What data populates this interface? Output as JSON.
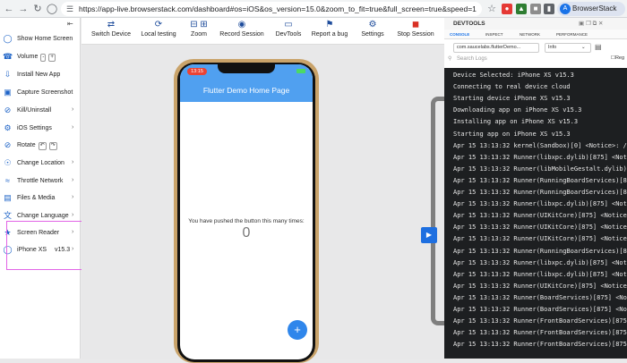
{
  "browser": {
    "url": "https://app-live.browserstack.com/dashboard#os=iOS&os_version=15.0&zoom_to_fit=true&full_screen=true&speed=1",
    "profile": "BrowserStack",
    "profile_initial": "A"
  },
  "sidebar": {
    "items": [
      {
        "label": "Show Home Screen",
        "icon": "home-circle-icon"
      },
      {
        "label": "Volume",
        "icon": "volume-icon"
      },
      {
        "label": "Install New App",
        "icon": "install-icon"
      },
      {
        "label": "Capture Screenshot",
        "icon": "screenshot-icon"
      },
      {
        "label": "Kill/Uninstall",
        "icon": "kill-icon"
      },
      {
        "label": "iOS Settings",
        "icon": "gear-icon"
      },
      {
        "label": "Rotate",
        "icon": "rotate-icon"
      },
      {
        "label": "Change Location",
        "icon": "location-icon"
      },
      {
        "label": "Throttle Network",
        "icon": "network-icon"
      },
      {
        "label": "Files & Media",
        "icon": "files-icon"
      },
      {
        "label": "Change Language",
        "icon": "language-icon"
      },
      {
        "label": "Screen Reader",
        "icon": "accessibility-icon"
      },
      {
        "label": "iPhone XS",
        "icon": "device-icon"
      }
    ],
    "volume_minus": "-",
    "volume_plus": "+",
    "rotate_keys": [
      "↶",
      "↷"
    ],
    "device_version": "v15.3"
  },
  "toolbar": {
    "items": [
      "Switch Device",
      "Local testing",
      "Zoom",
      "Record Session",
      "DevTools",
      "Report a bug",
      "Settings",
      "Stop Session"
    ]
  },
  "device": {
    "status_time": "13:15",
    "app_title": "Flutter Demo Home Page",
    "pushed_text": "You have pushed the button this many times:",
    "counter": "0",
    "fab_label": "+"
  },
  "devtools": {
    "title": "DEVTOOLS",
    "tabs": [
      "CONSOLE",
      "INSPECT",
      "NETWORK",
      "PERFORMANCE"
    ],
    "app_select": "com.saucelabs.flutterDemo...",
    "level_select": "Info",
    "search_placeholder": "Search Logs",
    "regex_label": "Reg",
    "logs": [
      "Device Selected: iPhone XS v15.3",
      "Connecting to real device cloud",
      "Starting device iPhone XS v15.3",
      "Downloading app on iPhone XS v15.3",
      "Installing app on iPhone XS v15.3",
      "Starting app on iPhone XS v15.3",
      "Apr 15 13:13:32 kernel(Sandbox)[0] <Notice>: /pr",
      "Apr 15 13:13:32 Runner(libxpc.dylib)[875] <Notic",
      "Apr 15 13:13:32 Runner(libMobileGestalt.dylib)[8",
      "Apr 15 13:13:32 Runner(RunningBoardServices)[875",
      "Apr 15 13:13:32 Runner(RunningBoardServices)[875",
      "Apr 15 13:13:32 Runner(libxpc.dylib)[875] <Notic",
      "Apr 15 13:13:32 Runner(UIKitCore)[875] <Notice>:",
      "Apr 15 13:13:32 Runner(UIKitCore)[875] <Notice>:",
      "Apr 15 13:13:32 Runner(UIKitCore)[875] <Notice>:",
      "Apr 15 13:13:32 Runner(RunningBoardServices)[875",
      "Apr 15 13:13:32 Runner(libxpc.dylib)[875] <Notic",
      "Apr 15 13:13:32 Runner(libxpc.dylib)[875] <Notic",
      "Apr 15 13:13:32 Runner(UIKitCore)[875] <Notice>:",
      "Apr 15 13:13:32 Runner(BoardServices)[875] <Noti",
      "Apr 15 13:13:32 Runner(BoardServices)[875] <Noti",
      "Apr 15 13:13:32 Runner(FrontBoardServices)[875]",
      "Apr 15 13:13:32 Runner(FrontBoardServices)[875]",
      "Apr 15 13:13:32 Runner(FrontBoardServices)[875]"
    ]
  }
}
